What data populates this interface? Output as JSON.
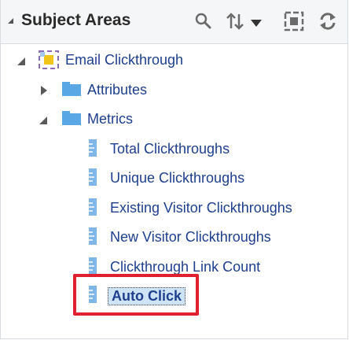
{
  "header": {
    "title": "Subject Areas"
  },
  "tree": {
    "root": {
      "label": "Email Clickthrough"
    },
    "folders": [
      {
        "label": "Attributes",
        "expanded": false
      },
      {
        "label": "Metrics",
        "expanded": true
      }
    ],
    "metrics": [
      {
        "label": "Total Clickthroughs"
      },
      {
        "label": "Unique Clickthroughs"
      },
      {
        "label": "Existing Visitor Clickthroughs"
      },
      {
        "label": "New Visitor Clickthroughs"
      },
      {
        "label": "Clickthrough Link Count"
      },
      {
        "label": "Auto Click",
        "selected": true
      }
    ]
  },
  "colors": {
    "link_text": "#1e3f8f",
    "folder": "#5aa7e6",
    "highlight": "#e0202e",
    "selection": "#cfe3f7"
  }
}
